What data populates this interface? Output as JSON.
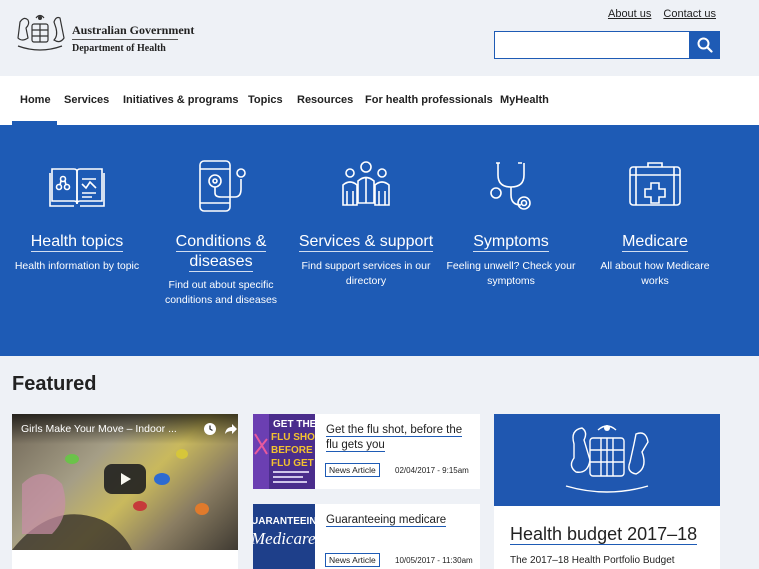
{
  "header": {
    "gov_name": "Australian Government",
    "department": "Department of Health",
    "links": {
      "about": "About us",
      "contact": "Contact us"
    },
    "search": {
      "placeholder": ""
    }
  },
  "nav": {
    "items": [
      "Home",
      "Services",
      "Initiatives & programs",
      "Topics",
      "Resources",
      "For health professionals",
      "MyHealth"
    ],
    "active": "Home"
  },
  "tiles": [
    {
      "title": "Health topics",
      "desc": "Health information by topic",
      "icon": "book-icon"
    },
    {
      "title": "Conditions & diseases",
      "title_l1": "Conditions &",
      "title_l2": "diseases",
      "desc": "Find out about specific conditions and diseases",
      "desc_l1": "Find out about specific",
      "desc_l2": "conditions and diseases",
      "icon": "phone-stethoscope-icon"
    },
    {
      "title": "Services & support",
      "desc": "Find support services in our directory",
      "desc_l1": "Find support services in our",
      "desc_l2": "directory",
      "icon": "people-icon"
    },
    {
      "title": "Symptoms",
      "desc": "Feeling unwell? Check your symptoms",
      "desc_l1": "Feeling unwell? Check your",
      "desc_l2": "symptoms",
      "icon": "stethoscope-icon"
    },
    {
      "title": "Medicare",
      "desc": "All about how Medicare works",
      "desc_l1": "All about how Medicare",
      "desc_l2": "works",
      "icon": "medical-kit-icon"
    }
  ],
  "featured": {
    "heading": "Featured",
    "video": {
      "title": "Girls Make Your Move – Indoor ..."
    },
    "news": [
      {
        "title": "Get the flu shot, before the flu gets you",
        "title_l1": "Get the flu shot, before the",
        "title_l2": "flu gets you",
        "tag": "News Article",
        "date": "02/04/2017 - 9:15am",
        "thumb_text": "GET THE FLU SHOT BEFORE FLU GETS"
      },
      {
        "title": "Guaranteeing medicare",
        "tag": "News Article",
        "date": "10/05/2017 - 11:30am",
        "thumb_text": "GUARANTEEING Medicare"
      }
    ],
    "budget": {
      "title": "Health budget 2017–18",
      "subtitle": "The 2017–18 Health Portfolio Budget"
    }
  },
  "colors": {
    "brand_blue": "#1e5bb5",
    "page_bg": "#eef1f6"
  }
}
